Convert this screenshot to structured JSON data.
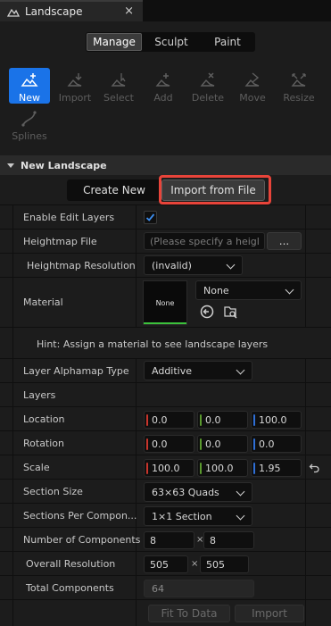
{
  "tab": {
    "title": "Landscape",
    "close_glyph": "×"
  },
  "modes": [
    "Manage",
    "Sculpt",
    "Paint"
  ],
  "active_mode": "Manage",
  "tools": [
    {
      "label": "New",
      "icon": "new-icon",
      "active": true
    },
    {
      "label": "Import",
      "icon": "import-icon",
      "active": false
    },
    {
      "label": "Select",
      "icon": "select-icon",
      "active": false
    },
    {
      "label": "Add",
      "icon": "add-icon",
      "active": false
    },
    {
      "label": "Delete",
      "icon": "delete-icon",
      "active": false
    },
    {
      "label": "Move",
      "icon": "move-icon",
      "active": false
    },
    {
      "label": "Resize",
      "icon": "resize-icon",
      "active": false
    },
    {
      "label": "Splines",
      "icon": "splines-icon",
      "active": false
    }
  ],
  "section": {
    "title": "New Landscape"
  },
  "sub_tabs": [
    "Create New",
    "Import from File"
  ],
  "active_sub_tab": "Import from File",
  "props": {
    "enable_edit_layers": {
      "label": "Enable Edit Layers",
      "checked": true
    },
    "heightmap_file": {
      "label": "Heightmap File",
      "placeholder": "(Please specify a heigl",
      "browse": "..."
    },
    "heightmap_resolution": {
      "label": "Heightmap Resolution",
      "value": "(invalid)"
    },
    "material": {
      "label": "Material",
      "thumb": "None",
      "value": "None"
    },
    "hint": "Hint: Assign a material to see landscape layers",
    "layer_alphamap_type": {
      "label": "Layer Alphamap Type",
      "value": "Additive"
    },
    "layers": {
      "label": "Layers"
    },
    "location": {
      "label": "Location",
      "x": "0.0",
      "y": "0.0",
      "z": "100.0"
    },
    "rotation": {
      "label": "Rotation",
      "x": "0.0",
      "y": "0.0",
      "z": "0.0"
    },
    "scale": {
      "label": "Scale",
      "x": "100.0",
      "y": "100.0",
      "z": "1.95"
    },
    "section_size": {
      "label": "Section Size",
      "value": "63×63 Quads"
    },
    "sections_per_component": {
      "label": "Sections Per Compon...",
      "value": "1×1 Section"
    },
    "number_of_components": {
      "label": "Number of Components",
      "x": "8",
      "y": "8",
      "times": "×"
    },
    "overall_resolution": {
      "label": "Overall Resolution",
      "x": "505",
      "y": "505",
      "times": "×"
    },
    "total_components": {
      "label": "Total Components",
      "value": "64"
    }
  },
  "buttons": {
    "fit_to_data": "Fit To Data",
    "import": "Import"
  },
  "colors": {
    "accent": "#1a73e8",
    "highlight": "#e8443a",
    "material_ok": "#3cc23c"
  }
}
